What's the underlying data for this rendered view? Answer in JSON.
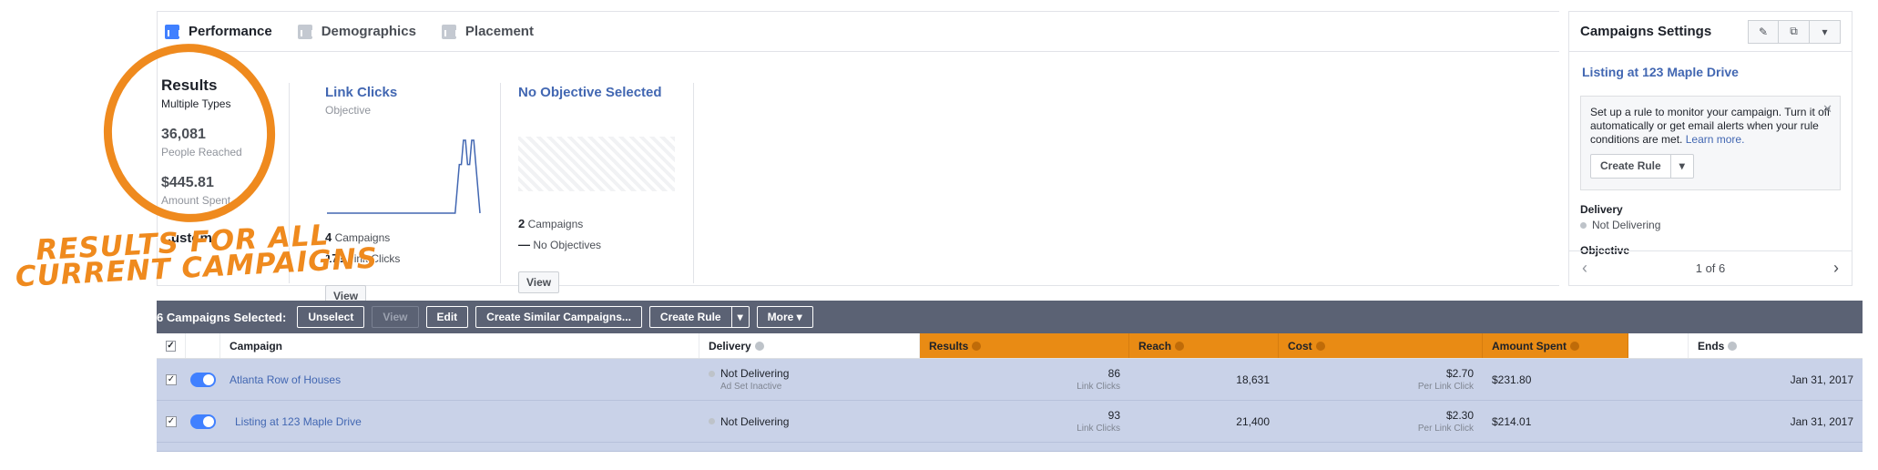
{
  "tabs": [
    {
      "label": "Performance"
    },
    {
      "label": "Demographics"
    },
    {
      "label": "Placement"
    }
  ],
  "summary": {
    "title": "Results",
    "subtitle": "Multiple Types",
    "reach_value": "36,081",
    "reach_label": "People Reached",
    "spent_value": "$445.81",
    "spent_label": "Amount Spent",
    "custom": "Custom"
  },
  "objectives": [
    {
      "title": "Link Clicks",
      "subtitle": "Objective",
      "campaigns_count": "4",
      "campaigns_label": "Campaigns",
      "metric_count": "179",
      "metric_label": "Link Clicks",
      "button": "View"
    },
    {
      "title": "No Objective Selected",
      "subtitle": "",
      "campaigns_count": "2",
      "campaigns_label": "Campaigns",
      "metric_count": "—",
      "metric_label": "No Objectives",
      "button": "View"
    }
  ],
  "chart_data": {
    "type": "line",
    "values": [
      0,
      0,
      0,
      0,
      0,
      0,
      0,
      0,
      0,
      0,
      0,
      0,
      0,
      0,
      0,
      0,
      0,
      0,
      0,
      0,
      0,
      0,
      0,
      0,
      0,
      0,
      0,
      0,
      0,
      0,
      0,
      0,
      0,
      0,
      0,
      0,
      0,
      0,
      0,
      0,
      0,
      0,
      0,
      0,
      0,
      0,
      0,
      0,
      0,
      0,
      0,
      0,
      0,
      0,
      0,
      0,
      0,
      0,
      0,
      0,
      0,
      0,
      0,
      1,
      2,
      2,
      3,
      3,
      2,
      2,
      3,
      3,
      2,
      1,
      0
    ],
    "title": "",
    "xlabel": "",
    "ylabel": ""
  },
  "settings": {
    "title": "Campaigns Settings",
    "campaign_link": "Listing at 123 Maple Drive",
    "rule_text": "Set up a rule to monitor your campaign. Turn it off automatically or get email alerts when your rule conditions are met.",
    "learn_more": "Learn more.",
    "close": "✕",
    "create_rule": "Create Rule",
    "delivery_label": "Delivery",
    "delivery_value": "Not Delivering",
    "objective_label": "Objective",
    "pager": "1 of 6",
    "edit_icon": "✎",
    "copy_icon": "⧉",
    "more_icon": "▾"
  },
  "toolbar": {
    "selected": "6 Campaigns Selected:",
    "unselect": "Unselect",
    "view": "View",
    "edit": "Edit",
    "create_similar": "Create Similar Campaigns...",
    "create_rule": "Create Rule",
    "more": "More ▾"
  },
  "columns": {
    "campaign": "Campaign",
    "delivery": "Delivery",
    "results": "Results",
    "reach": "Reach",
    "cost": "Cost",
    "amount_spent": "Amount Spent",
    "ends": "Ends"
  },
  "rows": [
    {
      "campaign": "Atlanta Row of Houses",
      "delivery": "Not Delivering",
      "delivery_sub": "Ad Set Inactive",
      "results": "86",
      "results_sub": "Link Clicks",
      "reach": "18,631",
      "cost": "$2.70",
      "cost_sub": "Per Link Click",
      "amount_spent": "$231.80",
      "ends": "Jan 31, 2017"
    },
    {
      "campaign": "Listing at 123 Maple Drive",
      "delivery": "Not Delivering",
      "delivery_sub": "",
      "results": "93",
      "results_sub": "Link Clicks",
      "reach": "21,400",
      "cost": "$2.30",
      "cost_sub": "Per Link Click",
      "amount_spent": "$214.01",
      "ends": "Jan 31, 2017"
    }
  ],
  "annotation": {
    "line1": "Results for all",
    "line2": "current campaigns"
  },
  "colors": {
    "accent": "#e98b14",
    "link": "#4267b2",
    "toolbar": "#5b6274",
    "row": "#c9d2e8"
  }
}
